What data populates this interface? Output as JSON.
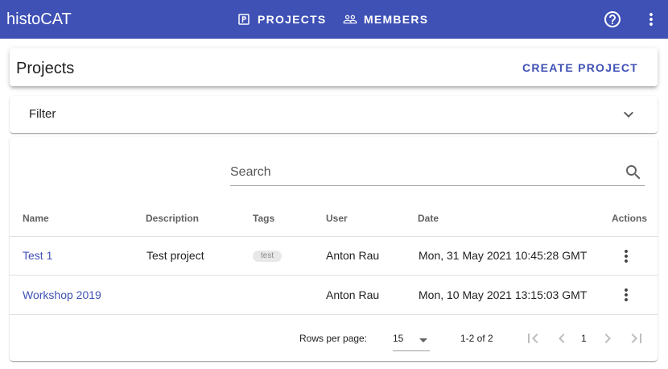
{
  "app": {
    "title": "histoCAT"
  },
  "nav": [
    {
      "label": "PROJECTS",
      "icon": "projects-icon"
    },
    {
      "label": "MEMBERS",
      "icon": "members-icon"
    }
  ],
  "toolbar": {
    "help_icon": "help-circle-icon",
    "menu_icon": "more-vert-icon"
  },
  "header": {
    "title": "Projects",
    "create_label": "CREATE PROJECT"
  },
  "filter": {
    "label": "Filter",
    "icon": "chevron-down-icon"
  },
  "search": {
    "placeholder": "Search",
    "value": "",
    "icon": "search-icon"
  },
  "table": {
    "columns": [
      "Name",
      "Description",
      "Tags",
      "User",
      "Date",
      "Actions"
    ],
    "rows": [
      {
        "name": "Test 1",
        "description": "Test project",
        "tags": [
          "test"
        ],
        "user": "Anton Rau",
        "date": "Mon, 31 May 2021 10:45:28 GMT"
      },
      {
        "name": "Workshop 2019",
        "description": "",
        "tags": [],
        "user": "Anton Rau",
        "date": "Mon, 10 May 2021 13:15:03 GMT"
      }
    ]
  },
  "pagination": {
    "rows_per_page_label": "Rows per page:",
    "rows_per_page": "15",
    "range": "1-2 of 2",
    "page": "1"
  },
  "colors": {
    "primary": "#3f51b5",
    "app_bar": "#3f51b5",
    "text": "#212121"
  }
}
